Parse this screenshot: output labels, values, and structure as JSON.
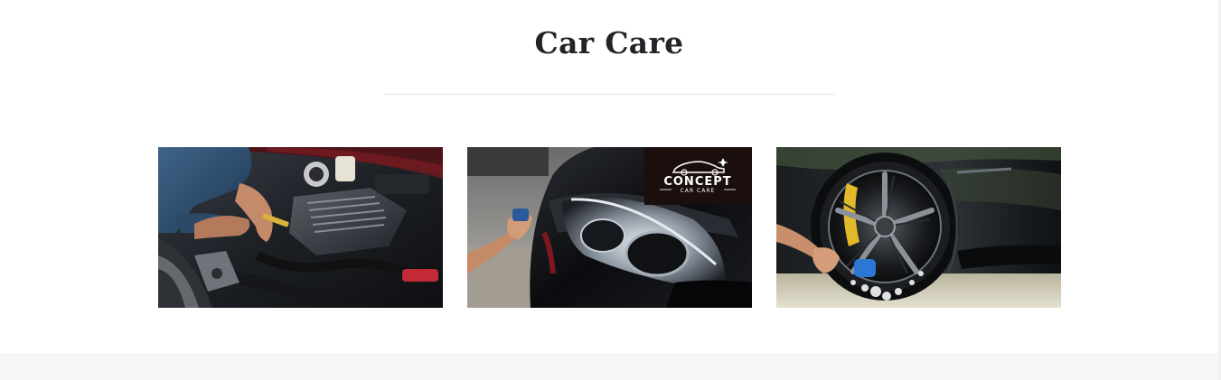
{
  "section": {
    "title": "Car Care"
  },
  "cards": [
    {
      "image": "engine-repair-photo",
      "alt": "mechanic working on car engine"
    },
    {
      "image": "headlight-detailing-photo",
      "alt": "detailing black car headlight",
      "logo": {
        "main": "CONCEPT",
        "sub": "CAR CARE"
      }
    },
    {
      "image": "wheel-washing-photo",
      "alt": "washing car wheel with foam"
    }
  ],
  "colors": {
    "title": "#222428",
    "divider": "#e6e6e6",
    "footer_band": "#f6f7f9",
    "logo_bg": "#1b0f0e"
  }
}
